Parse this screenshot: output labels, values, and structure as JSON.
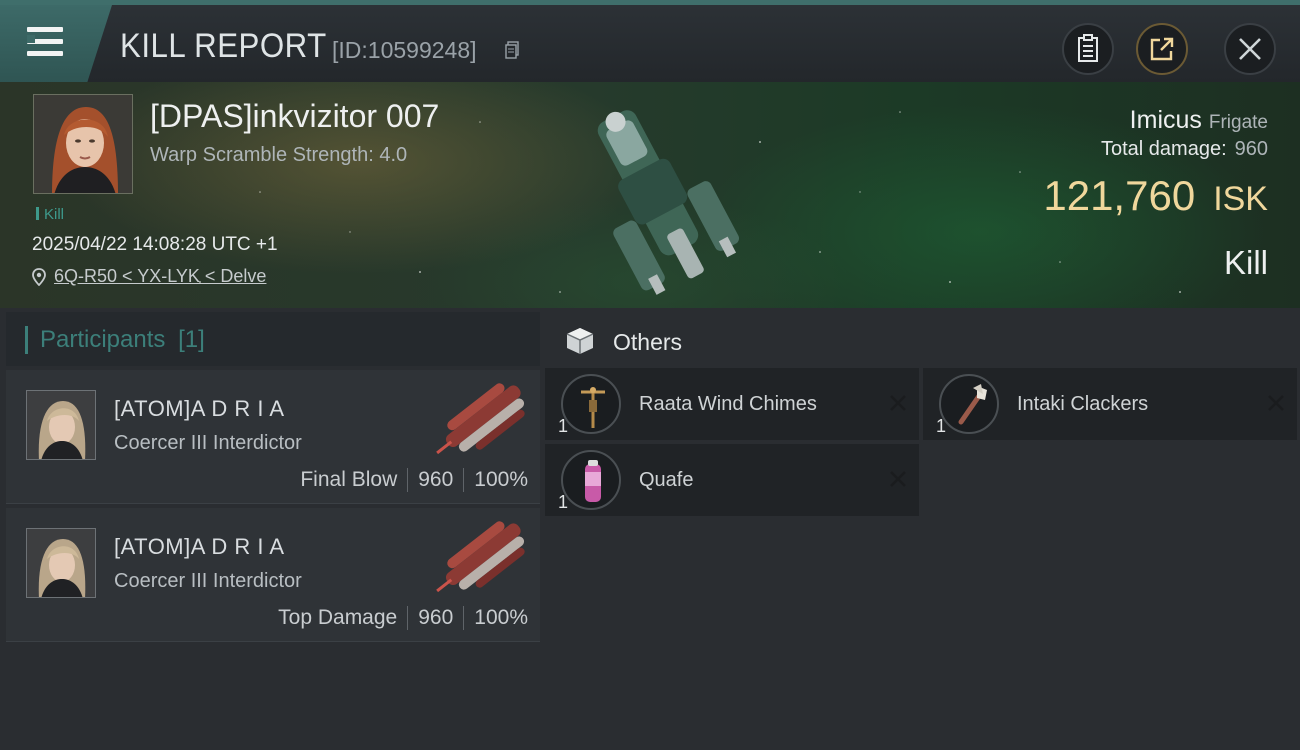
{
  "header": {
    "title": "KILL REPORT",
    "report_id": "[ID:10599248]",
    "icons": {
      "menu": "menu-icon",
      "copy": "copy-icon",
      "clipboard": "clipboard-icon",
      "share": "share-icon",
      "close": "close-icon"
    }
  },
  "victim": {
    "name": "[DPAS]inkvizitor 007",
    "warp_scramble": "Warp Scramble Strength: 4.0",
    "kill_tag": "Kill",
    "datetime": "2025/04/22 14:08:28 UTC +1",
    "location": "6Q-R50 < YX-LYK < Delve",
    "ship_name": "Imicus",
    "ship_class": "Frigate",
    "total_damage_label": "Total damage:",
    "total_damage_value": "960",
    "isk_value": "121,760",
    "isk_unit": "ISK",
    "result": "Kill"
  },
  "participants": {
    "label": "Participants",
    "count": "[1]",
    "rows": [
      {
        "name": "[ATOM]A D R I A",
        "ship": "Coercer III Interdictor",
        "role": "Final Blow",
        "damage": "960",
        "percent": "100%"
      },
      {
        "name": "[ATOM]A D R I A",
        "ship": "Coercer III Interdictor",
        "role": "Top Damage",
        "damage": "960",
        "percent": "100%"
      }
    ]
  },
  "others": {
    "label": "Others",
    "items": [
      {
        "name": "Raata Wind Chimes",
        "qty": "1"
      },
      {
        "name": "Intaki Clackers",
        "qty": "1"
      },
      {
        "name": "Quafe",
        "qty": "1"
      }
    ]
  },
  "colors": {
    "accent_teal": "#3c7f7a",
    "isk_gold": "#f0d79c",
    "header_teal": "#3d6a68"
  }
}
